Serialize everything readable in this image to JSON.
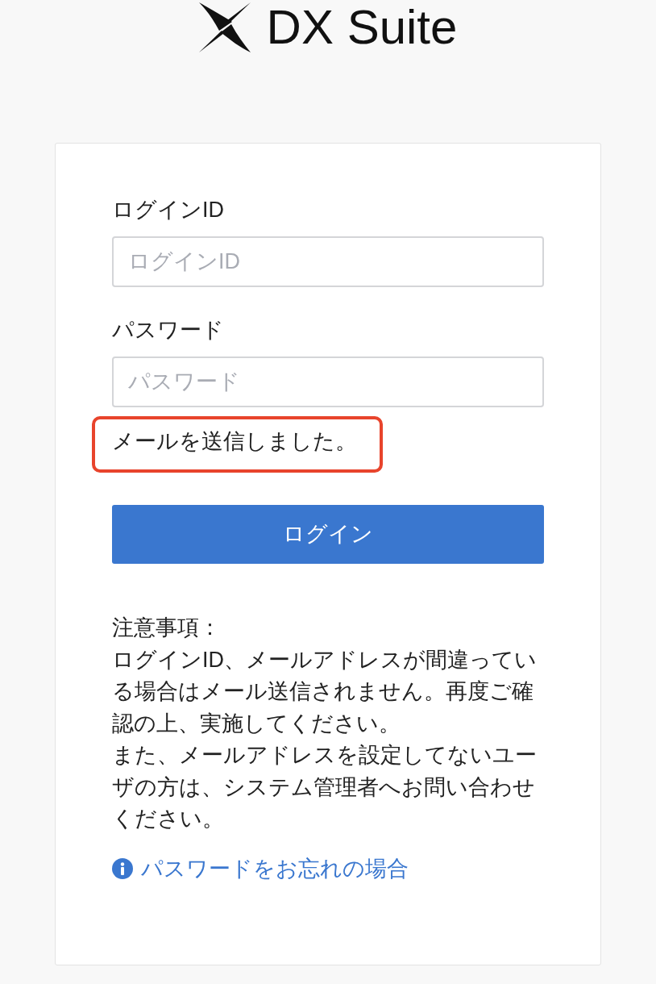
{
  "logo": {
    "text": "DX Suite"
  },
  "form": {
    "fields": [
      {
        "label": "ログインID",
        "placeholder": "ログインID"
      },
      {
        "label": "パスワード",
        "placeholder": "パスワード"
      }
    ],
    "message": {
      "text": "メールを送信しました。",
      "highlighted": true
    },
    "submit_button": {
      "label": "ログイン"
    },
    "notes": {
      "heading": "注意事項：",
      "paragraphs": [
        "ログインID、メールアドレスが間違っている場合はメール送信されません。再度ご確認の上、実施してください。",
        "また、メールアドレスを設定してないユーザの方は、システム管理者へお問い合わせください。"
      ]
    },
    "help_link": {
      "text": "パスワードをお忘れの場合"
    }
  }
}
